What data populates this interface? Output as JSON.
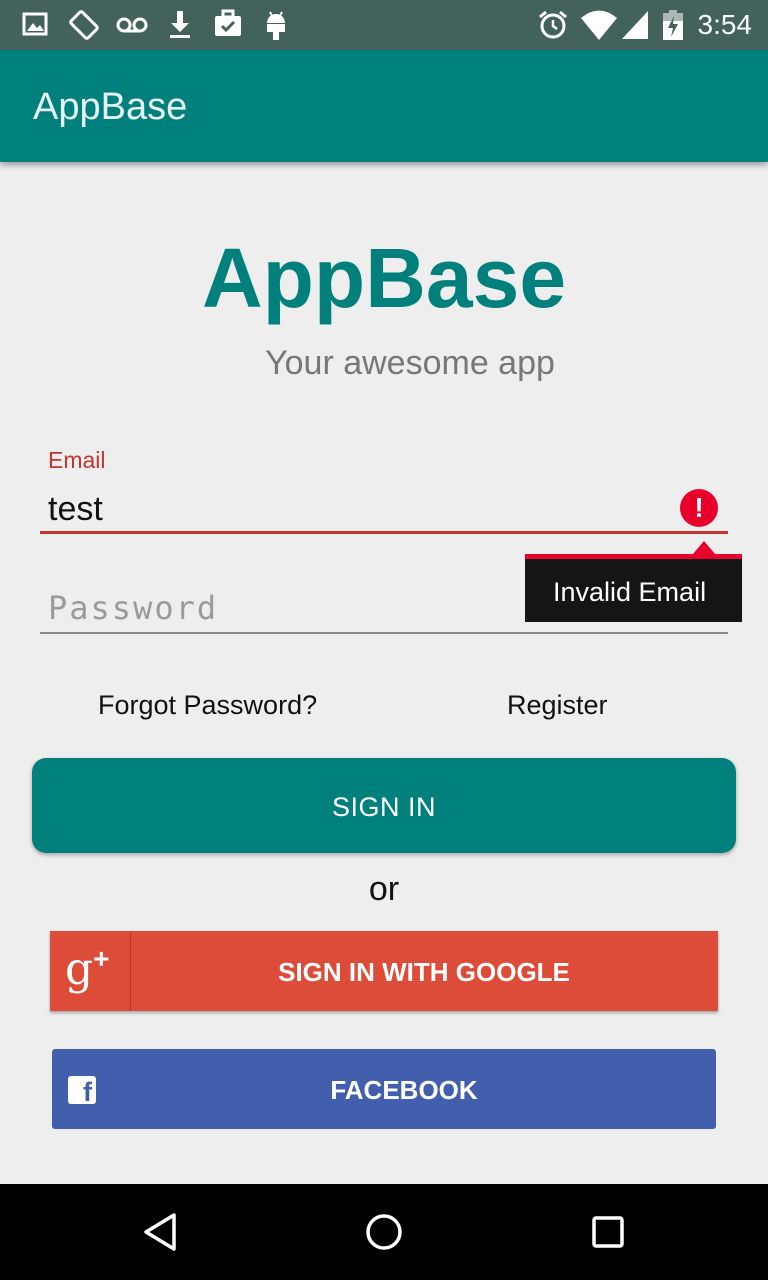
{
  "status_bar": {
    "time": "3:54",
    "left_icons": [
      "image-icon",
      "screen-rotation-icon",
      "voicemail-icon",
      "download-icon",
      "briefcase-check-icon",
      "android-icon"
    ],
    "right_icons": [
      "alarm-icon",
      "wifi-icon",
      "signal-icon",
      "battery-charging-icon"
    ]
  },
  "app_bar": {
    "title": "AppBase"
  },
  "logo": {
    "title": "AppBase",
    "tagline": "Your awesome app"
  },
  "form": {
    "email": {
      "label": "Email",
      "value": "test",
      "error": "Invalid Email"
    },
    "password": {
      "placeholder": "Password"
    },
    "forgot_password": "Forgot Password?",
    "register": "Register",
    "sign_in": "SIGN IN",
    "or": "or",
    "google": {
      "label": "SIGN IN WITH GOOGLE",
      "icon": "g+"
    },
    "facebook": {
      "label": "FACEBOOK",
      "icon": "f"
    }
  },
  "nav_bar": {
    "icons": [
      "back-icon",
      "home-icon",
      "recents-icon"
    ]
  },
  "colors": {
    "primary": "#00807d",
    "status_bar": "#44625c",
    "error": "#c4352d",
    "google": "#dd4b39",
    "facebook": "#425fae"
  }
}
